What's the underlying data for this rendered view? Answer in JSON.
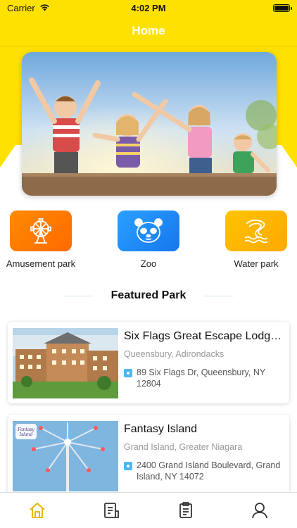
{
  "status_bar": {
    "carrier": "Carrier",
    "time": "4:02 PM"
  },
  "nav": {
    "title": "Home"
  },
  "hero": {
    "image": "kids-jumping-photo"
  },
  "categories": [
    {
      "label": "Amusement park",
      "icon": "ferris-wheel-icon",
      "color": "#ff7a00"
    },
    {
      "label": "Zoo",
      "icon": "panda-icon",
      "color": "#1e90ff"
    },
    {
      "label": "Water park",
      "icon": "water-slide-icon",
      "color": "#ffb800"
    }
  ],
  "featured": {
    "title": "Featured Park",
    "parks": [
      {
        "name": "Six Flags Great Escape Lodge...",
        "area": "Queensbury, Adirondacks",
        "address": "89 Six Flags Dr, Queensbury, NY 12804"
      },
      {
        "name": "Fantasy Island",
        "area": "Grand Island, Greater Niagara",
        "address": "2400 Grand Island Boulevard, Grand Island, NY 14072",
        "logo_text": "Fantasy Island"
      }
    ]
  },
  "tabs": [
    {
      "icon": "home-icon",
      "active": true
    },
    {
      "icon": "document-icon",
      "active": false
    },
    {
      "icon": "clipboard-icon",
      "active": false
    },
    {
      "icon": "profile-icon",
      "active": false
    }
  ],
  "colors": {
    "accent": "#ffe100",
    "active_tab": "#e8b700",
    "inactive_tab": "#333333"
  }
}
